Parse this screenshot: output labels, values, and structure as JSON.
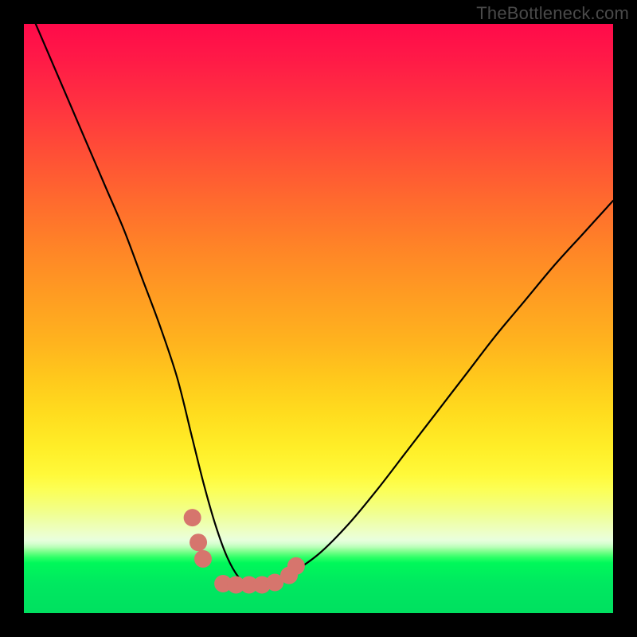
{
  "watermark": "TheBottleneck.com",
  "chart_data": {
    "type": "line",
    "title": "",
    "xlabel": "",
    "ylabel": "",
    "xlim": [
      0,
      100
    ],
    "ylim": [
      0,
      100
    ],
    "grid": false,
    "legend": false,
    "series": [
      {
        "name": "bottleneck-curve",
        "x": [
          2,
          5,
          8,
          11,
          14,
          17,
          20,
          23,
          26,
          28.5,
          30.5,
          32.5,
          34.5,
          36.5,
          38,
          42,
          45,
          50,
          55,
          60,
          65,
          70,
          75,
          80,
          85,
          90,
          95,
          100
        ],
        "y": [
          100,
          93,
          86,
          79,
          72,
          65,
          57,
          49,
          40,
          30,
          22,
          15,
          9.5,
          6,
          5,
          5,
          6.5,
          10,
          15,
          21,
          27.5,
          34,
          40.5,
          47,
          53,
          59,
          64.5,
          70
        ]
      }
    ],
    "valley_markers": {
      "name": "valley-highlight-dots",
      "color": "#d6756d",
      "points": [
        {
          "x": 28.6,
          "y": 16.2
        },
        {
          "x": 29.6,
          "y": 12.0
        },
        {
          "x": 30.4,
          "y": 9.2
        },
        {
          "x": 33.8,
          "y": 5.0
        },
        {
          "x": 36.0,
          "y": 4.8
        },
        {
          "x": 38.2,
          "y": 4.8
        },
        {
          "x": 40.4,
          "y": 4.8
        },
        {
          "x": 42.6,
          "y": 5.2
        },
        {
          "x": 45.0,
          "y": 6.4
        },
        {
          "x": 46.2,
          "y": 8.0
        }
      ]
    },
    "background_gradient": {
      "top": "#ff0a4a",
      "mid": "#ffee28",
      "bottom_band_pale": "#edffc0",
      "bottom": "#00e860"
    }
  }
}
